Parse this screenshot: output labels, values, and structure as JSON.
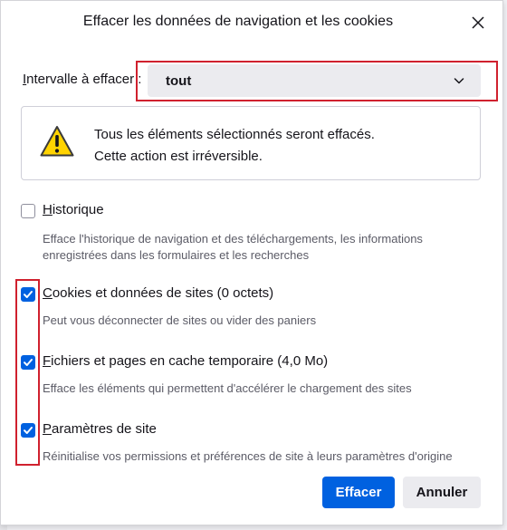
{
  "dialog": {
    "title": "Effacer les données de navigation et les cookies",
    "close_icon": "close-icon"
  },
  "range": {
    "label_accesskey": "I",
    "label_rest": "ntervalle à effacer :",
    "value": "tout"
  },
  "warning": {
    "icon": "warning-icon",
    "line1": "Tous les éléments sélectionnés seront effacés.",
    "line2": "Cette action est irréversible."
  },
  "items": [
    {
      "checked": false,
      "label_accesskey": "H",
      "label_rest": "istorique",
      "desc_line1": "Efface l'historique de navigation et des téléchargements, les informations",
      "desc_line2": "enregistrées dans les formulaires et les recherches"
    },
    {
      "checked": true,
      "label_accesskey": "C",
      "label_rest": "ookies et données de sites (0 octets)",
      "desc_line1": "Peut vous déconnecter de sites ou vider des paniers"
    },
    {
      "checked": true,
      "label_accesskey": "F",
      "label_rest": "ichiers et pages en cache temporaire (4,0 Mo)",
      "desc_line1": "Efface les éléments qui permettent d'accélérer le chargement des sites"
    },
    {
      "checked": true,
      "label_accesskey": "P",
      "label_rest": "aramètres de site",
      "desc_line1": "Réinitialise vos permissions et préférences de site à leurs paramètres d'origine"
    }
  ],
  "buttons": {
    "clear": "Effacer",
    "cancel": "Annuler"
  },
  "colors": {
    "accent": "#0061e0",
    "highlight": "#d0212e",
    "warning": "#ffd300"
  }
}
